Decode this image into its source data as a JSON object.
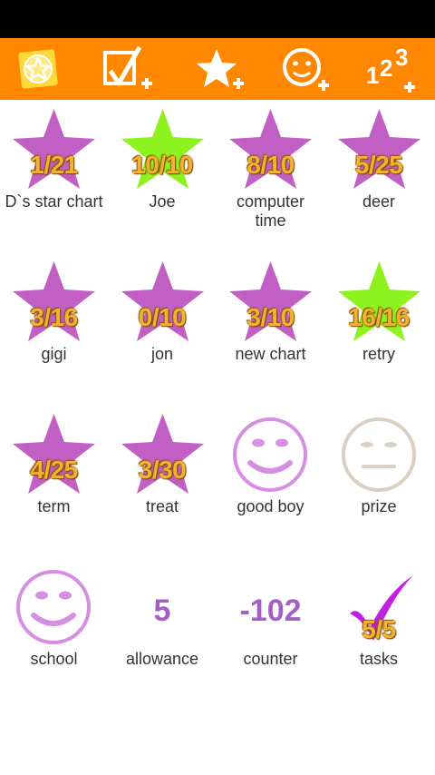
{
  "toolbar": {
    "buttons": [
      {
        "name": "star-chart-logo",
        "icon": "star-badge-icon"
      },
      {
        "name": "add-task",
        "icon": "checkbox-plus-icon"
      },
      {
        "name": "add-star-chart",
        "icon": "star-plus-icon"
      },
      {
        "name": "add-smiley",
        "icon": "smiley-plus-icon"
      },
      {
        "name": "add-counter",
        "icon": "numbers-plus-icon"
      }
    ],
    "counter_icon_text": "123"
  },
  "colors": {
    "toolbar": "#ff8800",
    "star_purple": "#c25fc4",
    "star_green": "#8ef21e",
    "progress_text": "#f4b233",
    "smiley_purple": "#d68ee3",
    "smiley_beige": "#d9d0c2"
  },
  "items": [
    {
      "label": "D`s star chart",
      "type": "star",
      "color": "purple",
      "progress": "1/21"
    },
    {
      "label": "Joe",
      "type": "star",
      "color": "green",
      "progress": "10/10"
    },
    {
      "label": "computer time",
      "type": "star",
      "color": "purple",
      "progress": "8/10"
    },
    {
      "label": "deer",
      "type": "star",
      "color": "purple",
      "progress": "5/25"
    },
    {
      "label": "gigi",
      "type": "star",
      "color": "purple",
      "progress": "3/16"
    },
    {
      "label": "jon",
      "type": "star",
      "color": "purple",
      "progress": "0/10"
    },
    {
      "label": "new chart",
      "type": "star",
      "color": "purple",
      "progress": "3/10"
    },
    {
      "label": "retry",
      "type": "star",
      "color": "green",
      "progress": "16/16"
    },
    {
      "label": "term",
      "type": "star",
      "color": "purple",
      "progress": "4/25"
    },
    {
      "label": "treat",
      "type": "star",
      "color": "purple",
      "progress": "3/30"
    },
    {
      "label": "good boy",
      "type": "smiley",
      "mood": "happy"
    },
    {
      "label": "prize",
      "type": "smiley",
      "mood": "neutral"
    },
    {
      "label": "school",
      "type": "smiley",
      "mood": "happy"
    },
    {
      "label": "allowance",
      "type": "counter",
      "value": "5"
    },
    {
      "label": "counter",
      "type": "counter",
      "value": "-102"
    },
    {
      "label": "tasks",
      "type": "task",
      "progress": "5/5"
    }
  ]
}
